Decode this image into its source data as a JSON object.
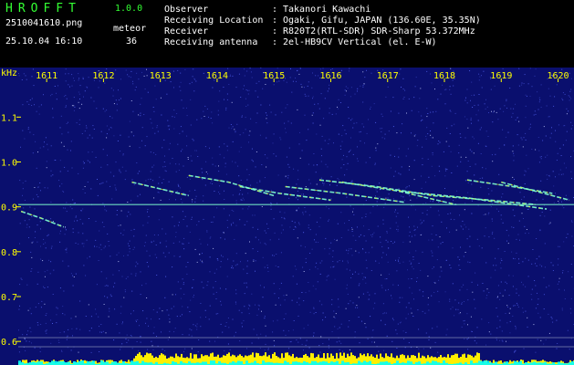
{
  "header": {
    "app_title": "HROFFT",
    "version": "1.0.0",
    "filename": "2510041610.png",
    "kind": "meteor",
    "datetime": "25.10.04 16:10",
    "count": "36",
    "info": [
      {
        "label": "Observer",
        "value": "Takanori Kawachi"
      },
      {
        "label": "Receiving Location",
        "value": "Ogaki, Gifu, JAPAN (136.60E, 35.35N)"
      },
      {
        "label": "Receiver",
        "value": "R820T2(RTL-SDR) SDR-Sharp 53.372MHz"
      },
      {
        "label": "Receiving antenna",
        "value": "2el-HB9CV Vertical (el. E-W)"
      }
    ]
  },
  "colors": {
    "header_green": "#33ff33",
    "axis_yellow": "#ffff00",
    "background_blue": "#0a0f6e",
    "noise_dots": "#5a6bff",
    "trail_cyan": "#7fffd0",
    "signal_yellow": "#ffee00",
    "floor_cyan": "#00ffff"
  },
  "chart_data": {
    "type": "heatmap",
    "ylabel": "kHz",
    "x_ticks": [
      "1611",
      "1612",
      "1613",
      "1614",
      "1615",
      "1616",
      "1617",
      "1618",
      "1619",
      "1620"
    ],
    "y_ticks": [
      "1.1",
      "1.0",
      "0.9",
      "0.8",
      "0.7",
      "0.6"
    ],
    "x_range": [
      1610.5,
      1620.2
    ],
    "y_range": [
      0.58,
      1.18
    ],
    "carrier_khz": 0.905,
    "echo_traces": [
      {
        "x": [
          1612.5,
          1613.0,
          1613.5
        ],
        "y": [
          0.955,
          0.94,
          0.925
        ]
      },
      {
        "x": [
          1613.5,
          1614.2,
          1615.0
        ],
        "y": [
          0.97,
          0.955,
          0.925
        ]
      },
      {
        "x": [
          1614.4,
          1615.1,
          1616.0
        ],
        "y": [
          0.945,
          0.93,
          0.915
        ]
      },
      {
        "x": [
          1615.2,
          1616.2,
          1617.3
        ],
        "y": [
          0.945,
          0.93,
          0.91
        ]
      },
      {
        "x": [
          1615.8,
          1616.8,
          1617.8
        ],
        "y": [
          0.96,
          0.945,
          0.925
        ]
      },
      {
        "x": [
          1616.2,
          1617.2,
          1618.2
        ],
        "y": [
          0.955,
          0.935,
          0.905
        ]
      },
      {
        "x": [
          1617.2,
          1618.4,
          1619.8
        ],
        "y": [
          0.935,
          0.92,
          0.895
        ]
      },
      {
        "x": [
          1617.8,
          1618.8,
          1619.6
        ],
        "y": [
          0.925,
          0.915,
          0.905
        ]
      },
      {
        "x": [
          1618.4,
          1619.2,
          1619.9
        ],
        "y": [
          0.96,
          0.945,
          0.93
        ]
      },
      {
        "x": [
          1619.0,
          1619.6,
          1620.2
        ],
        "y": [
          0.955,
          0.935,
          0.915
        ]
      },
      {
        "x": [
          1610.55,
          1610.9,
          1611.3
        ],
        "y": [
          0.89,
          0.875,
          0.855
        ]
      }
    ]
  }
}
